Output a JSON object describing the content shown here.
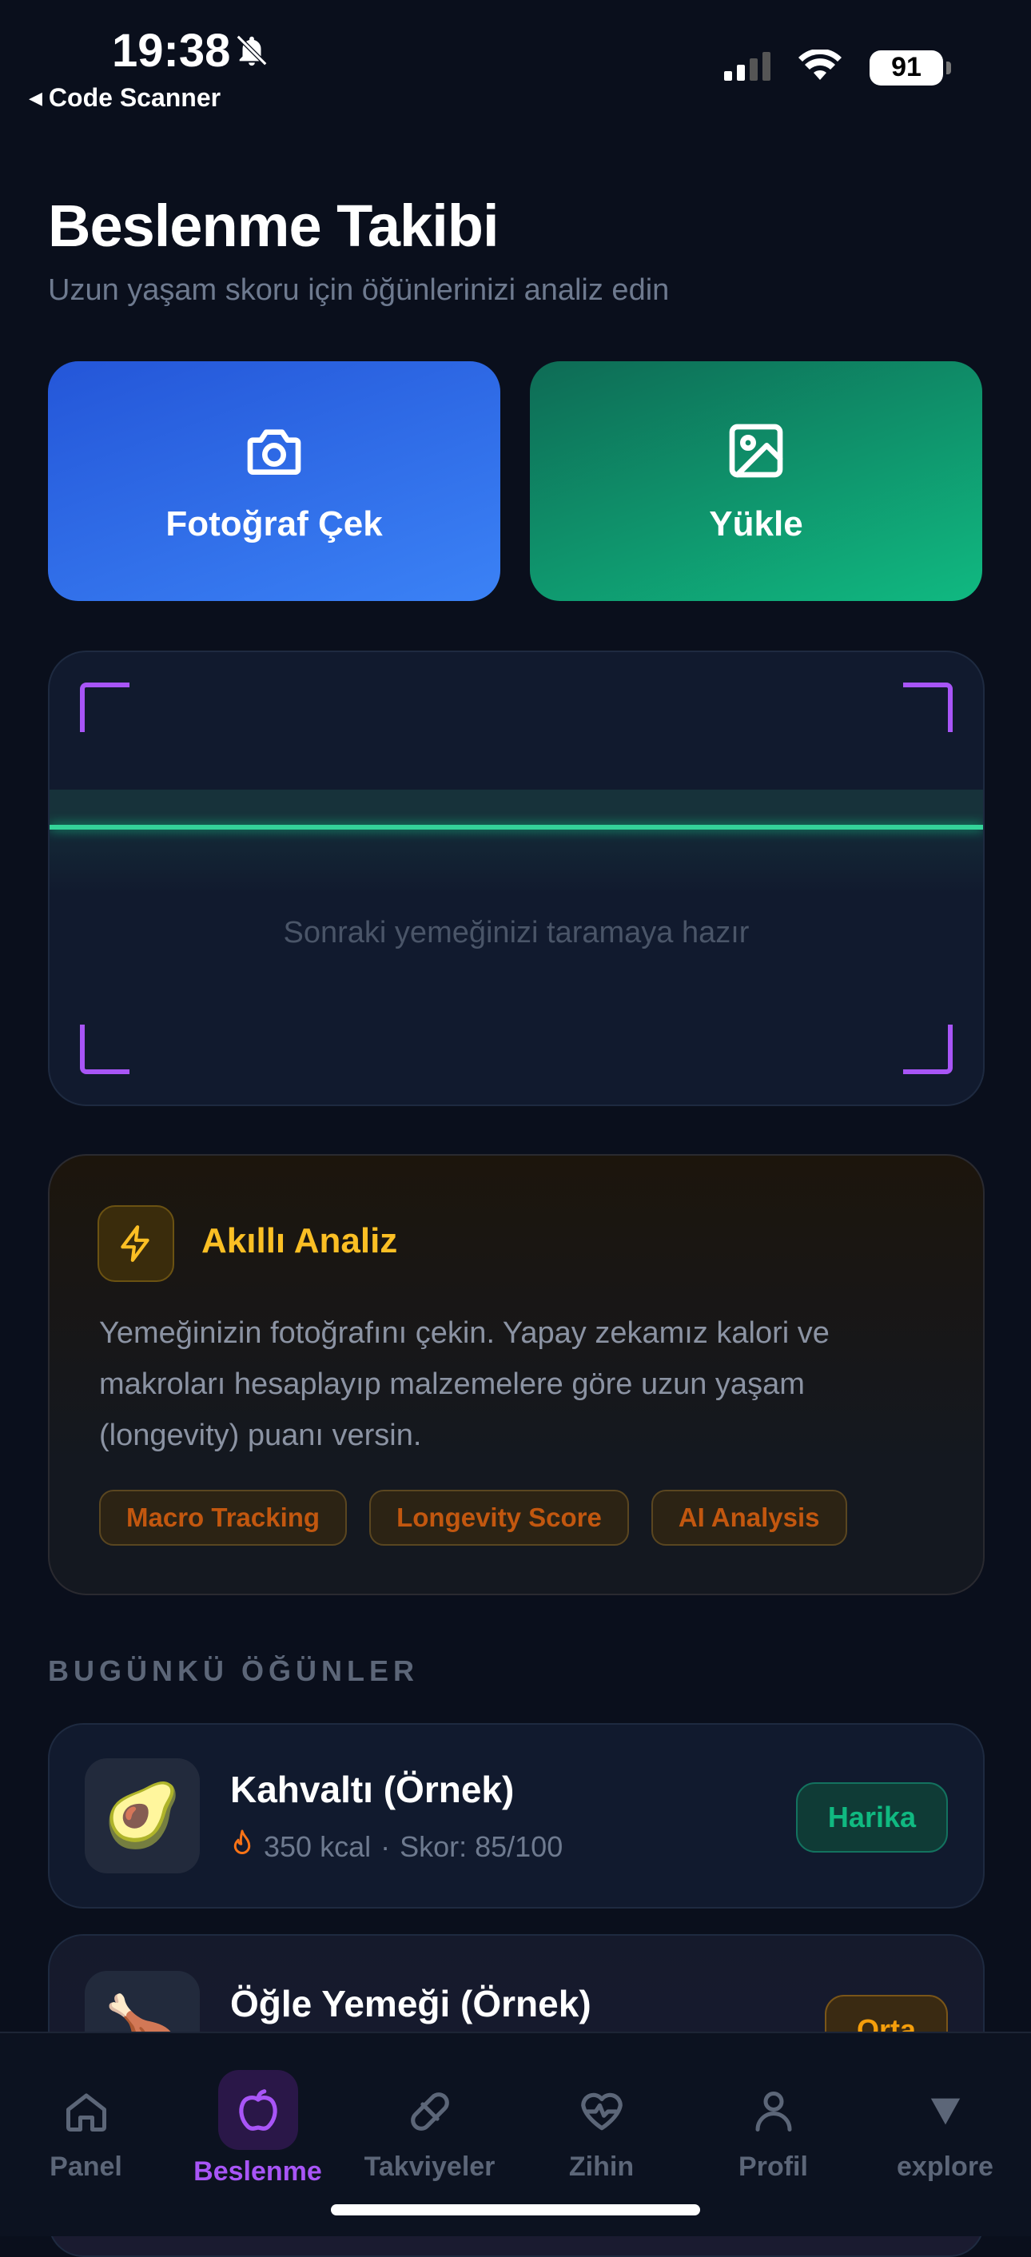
{
  "status_bar": {
    "time": "19:38",
    "back_app": "Code Scanner",
    "battery": "91"
  },
  "header": {
    "title": "Beslenme Takibi",
    "subtitle": "Uzun yaşam skoru için öğünlerinizi analiz edin"
  },
  "actions": {
    "camera_label": "Fotoğraf Çek",
    "upload_label": "Yükle"
  },
  "scanner": {
    "status_text": "Sonraki yemeğinizi taramaya hazır"
  },
  "analysis": {
    "title": "Akıllı Analiz",
    "body": "Yemeğinizin fotoğrafını çekin. Yapay zekamız kalori ve makroları hesaplayıp malzemelere göre uzun yaşam (longevity) puanı versin.",
    "tags": [
      "Macro Tracking",
      "Longevity Score",
      "AI Analysis"
    ]
  },
  "meals_section": {
    "label": "BUGÜNKÜ ÖĞÜNLER",
    "items": [
      {
        "name": "Kahvaltı (Örnek)",
        "kcal": "350 kcal",
        "separator": "·",
        "score": "Skor: 85/100",
        "badge": "Harika",
        "emoji": "🥑"
      },
      {
        "name": "Öğle Yemeği (Örnek)",
        "badge": "Orta",
        "emoji": "🍗"
      }
    ]
  },
  "tabbar": {
    "tabs": [
      {
        "label": "Panel",
        "icon": "home-icon"
      },
      {
        "label": "Beslenme",
        "icon": "apple-icon",
        "active": true
      },
      {
        "label": "Takviyeler",
        "icon": "pill-icon"
      },
      {
        "label": "Zihin",
        "icon": "heart-pulse-icon"
      },
      {
        "label": "Profil",
        "icon": "user-icon"
      },
      {
        "label": "explore",
        "icon": "triangle-down-icon"
      }
    ]
  },
  "colors": {
    "background": "#0a0f1c",
    "accent_purple": "#a855f7",
    "camera_blue": "#3b82f6",
    "upload_green": "#10b981",
    "analysis_amber": "#fbbf24"
  }
}
